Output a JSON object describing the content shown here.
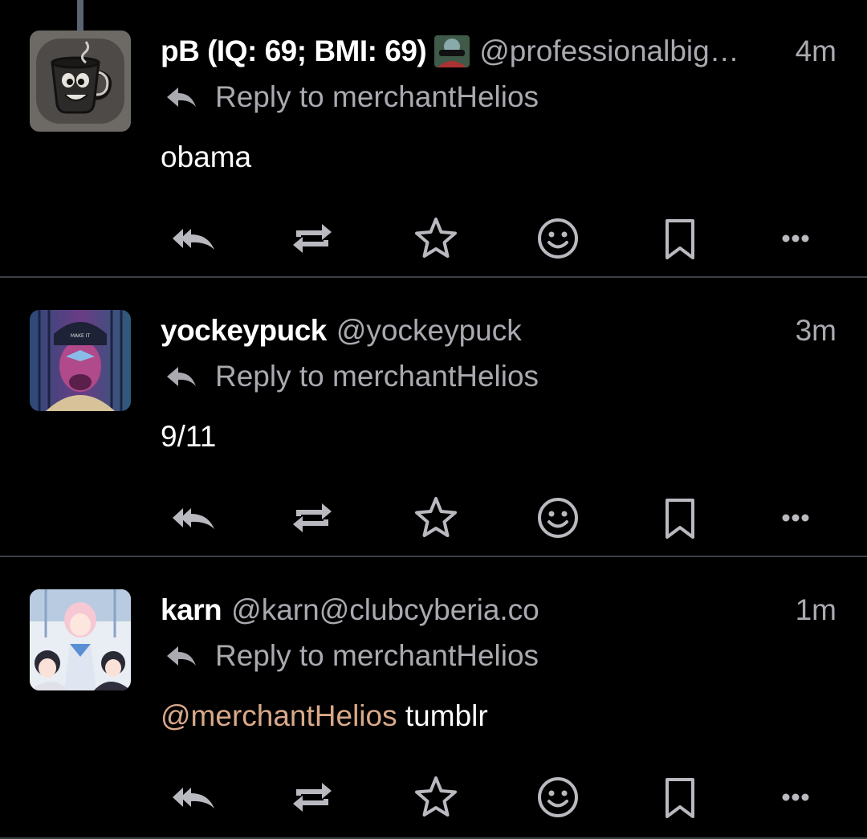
{
  "posts": [
    {
      "display_name": "pB (IQ: 69; BMI: 69)",
      "handle": "@professionalbig…",
      "time": "4m",
      "reply_to": "Reply to merchantHelios",
      "content": "obama",
      "avatar": "cartoon-coffee-cup",
      "has_flair": true
    },
    {
      "display_name": "yockeypuck",
      "handle": "@yockeypuck",
      "time": "3m",
      "reply_to": "Reply to merchantHelios",
      "content": "9/11",
      "avatar": "man-in-cap-portrait"
    },
    {
      "display_name": "karn",
      "handle": "@karn@clubcyberia.co",
      "time": "1m",
      "reply_to": "Reply to merchantHelios",
      "content_mention": "@merchantHelios",
      "content_text": " tumblr",
      "avatar": "anime-group-image"
    }
  ],
  "actions": [
    "reply-all-icon",
    "boost-icon",
    "favourite-icon",
    "emoji-reaction-icon",
    "bookmark-icon",
    "more-icon"
  ],
  "colors": {
    "background": "#000000",
    "secondary_text": "#a9a9b0",
    "mention": "#d9a98a",
    "divider": "#3a3f46"
  }
}
